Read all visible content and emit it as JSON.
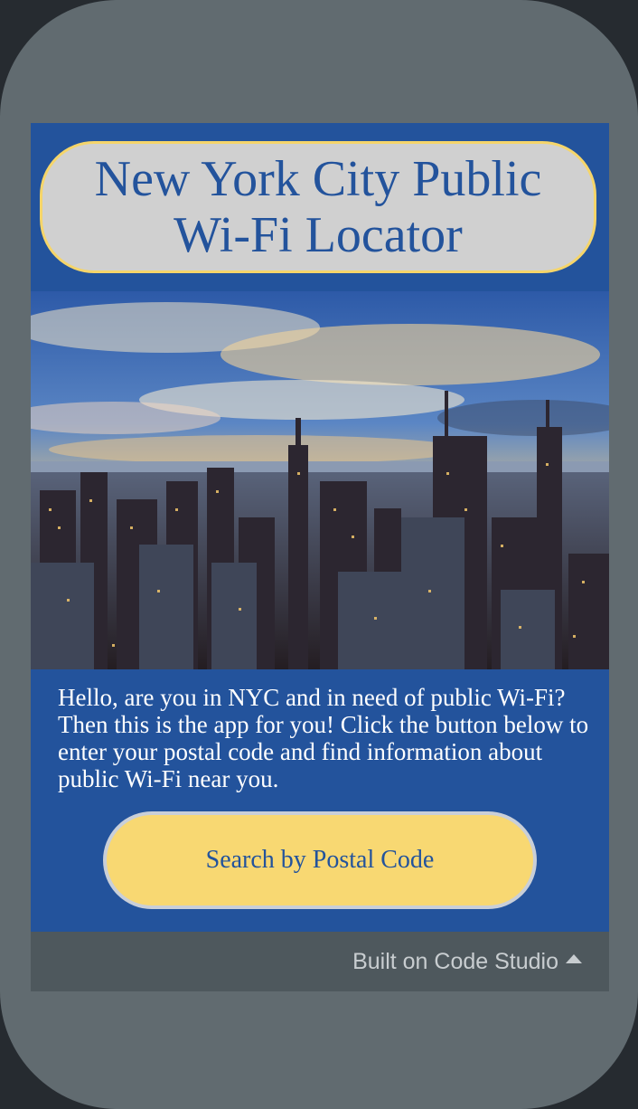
{
  "app": {
    "title": "New York City Public Wi-Fi Locator",
    "hero_image": "nyc-skyline-icon",
    "intro_text": "Hello, are you in NYC and in need of public Wi-Fi? Then this is the app for you! Click the button below to enter your postal code and find information about public Wi-Fi near you.",
    "search_button_label": "Search by Postal Code"
  },
  "footer": {
    "label": "Built on Code Studio",
    "toggle_icon": "caret-up-icon"
  },
  "colors": {
    "screen_background": "#23539c",
    "title_pill_background": "#d0d0d0",
    "title_pill_border": "#f5d56a",
    "button_background": "#f8d872",
    "phone_frame": "#616b70",
    "footer_background": "#4e585d"
  }
}
